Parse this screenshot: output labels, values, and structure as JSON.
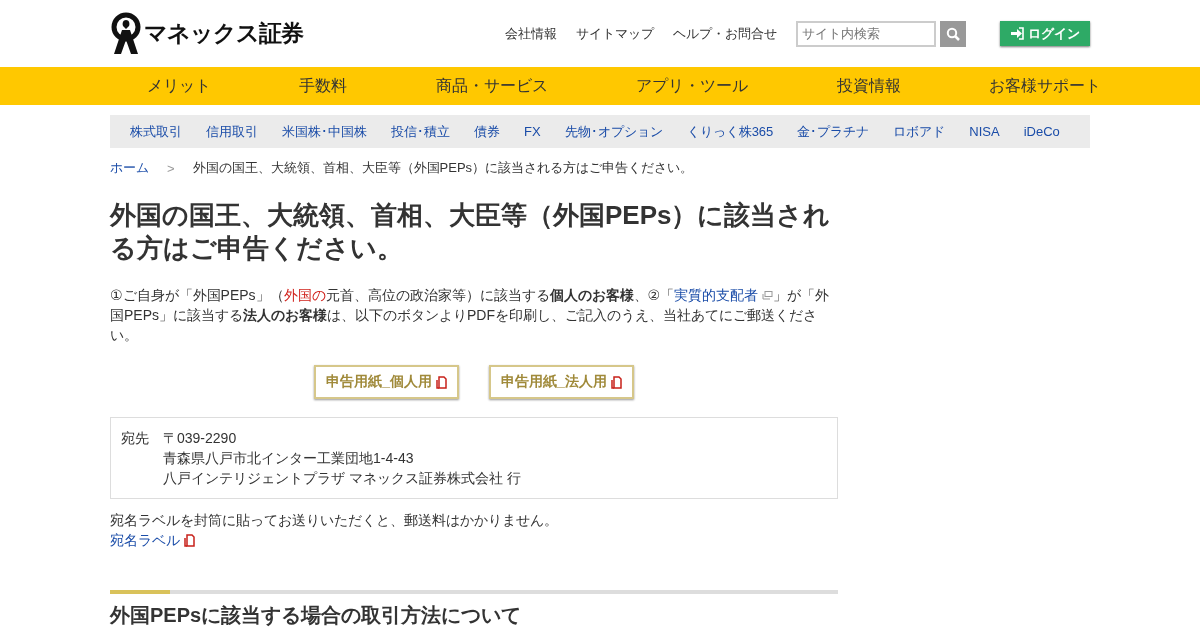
{
  "header": {
    "logo_text": "マネックス証券",
    "links": [
      "会社情報",
      "サイトマップ",
      "ヘルプ・お問合せ"
    ],
    "search": {
      "placeholder": "サイト内検索"
    },
    "login": "ログイン"
  },
  "main_nav": [
    "メリット",
    "手数料",
    "商品・サービス",
    "アプリ・ツール",
    "投資情報",
    "お客様サポート"
  ],
  "sub_nav": [
    "株式取引",
    "信用取引",
    "米国株･中国株",
    "投信･積立",
    "債券",
    "FX",
    "先物･オプション",
    "くりっく株365",
    "金･プラチナ",
    "ロボアド",
    "NISA",
    "iDeCo"
  ],
  "breadcrumb": {
    "separator": ">",
    "items": [
      "ホーム",
      "外国の国王、大統領、首相、大臣等（外国PEPs）に該当される方はご申告ください。"
    ]
  },
  "title": "外国の国王、大統領、首相、大臣等（外国PEPs）に該当される方はご申告ください。",
  "intro": [
    {
      "kind": "text",
      "text": "①ご自身が「外国PEPs」（"
    },
    {
      "kind": "red",
      "text": "外国の"
    },
    {
      "kind": "text",
      "text": "元首、高位の政治家等）に該当する"
    },
    {
      "kind": "bold",
      "text": "個人のお客様"
    },
    {
      "kind": "text",
      "text": "、②「"
    },
    {
      "kind": "link",
      "text": "実質的支配者"
    },
    {
      "kind": "text",
      "text": "」が「外国PEPs」に該当する"
    },
    {
      "kind": "bold",
      "text": "法人のお客様"
    },
    {
      "kind": "text",
      "text": "は、以下のボタンよりPDFを印刷し、ご記入のうえ、当社あてにご郵送ください。"
    }
  ],
  "pdf_buttons": [
    "申告用紙_個人用",
    "申告用紙_法人用"
  ],
  "address": {
    "label": "宛先",
    "lines": [
      "〒039-2290",
      "青森県八戸市北インター工業団地1-4-43",
      "八戸インテリジェントプラザ マネックス証券株式会社 行"
    ]
  },
  "note": "宛名ラベルを封筒に貼ってお送りいただくと、郵送料はかかりません。",
  "label_link": "宛名ラベル",
  "section_heading": "外国PEPsに該当する場合の取引方法について"
}
